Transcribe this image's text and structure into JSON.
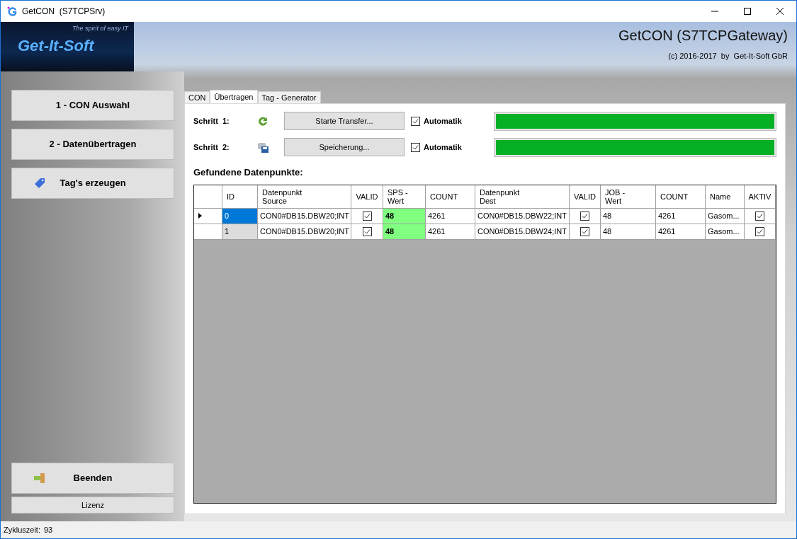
{
  "window": {
    "title": "GetCON  (S7TCPSrv)"
  },
  "header": {
    "logo_text": "Get-It-Soft",
    "logo_slogan": "The spirit of easy IT",
    "title": "GetCON (S7TCPGateway)",
    "copyright": "(c) 2016-2017  by  Get-It-Soft GbR"
  },
  "sidebar": {
    "items": [
      {
        "label": "1 - CON Auswahl",
        "kind": "plain"
      },
      {
        "label": "2 - Datenübertragen",
        "kind": "plain"
      },
      {
        "label": "Tag's erzeugen",
        "kind": "tag"
      }
    ],
    "exit_button": "Beenden",
    "license_button": "Lizenz"
  },
  "tabs": [
    {
      "label": "CON",
      "selected": false
    },
    {
      "label": "Übertragen",
      "selected": true
    },
    {
      "label": "Tag - Generator",
      "selected": false
    }
  ],
  "steps": [
    {
      "label": "Schritt  1:",
      "kind": "refresh",
      "button": "Starte Transfer...",
      "auto_label": "Automatik",
      "auto_checked": true,
      "level": 1
    },
    {
      "label": "Schritt  2:",
      "kind": "save",
      "button": "Speicherung...",
      "auto_label": "Automatik",
      "auto_checked": true,
      "level": 1
    }
  ],
  "table": {
    "title": "Gefundene Datenpunkte:",
    "columns": [
      {
        "label": "ID",
        "kind": "text"
      },
      {
        "label": "Datenpunkt Source",
        "kind": "text"
      },
      {
        "label": "VALID",
        "kind": "check"
      },
      {
        "label": "SPS - Wert",
        "kind": "value"
      },
      {
        "label": "COUNT",
        "kind": "text"
      },
      {
        "label": "Datenpunkt Dest",
        "kind": "text"
      },
      {
        "label": "VALID",
        "kind": "check"
      },
      {
        "label": "JOB - Wert",
        "kind": "text"
      },
      {
        "label": "COUNT",
        "kind": "text"
      },
      {
        "label": "Name",
        "kind": "text"
      },
      {
        "label": "AKTIV",
        "kind": "check"
      }
    ],
    "rows": [
      {
        "selected": true,
        "cells": [
          "0",
          "CON0#DB15.DBW20;INT",
          true,
          "48",
          "4261",
          "CON0#DB15.DBW22;INT",
          true,
          "48",
          "4261",
          "Gasom...",
          true
        ]
      },
      {
        "selected": false,
        "cells": [
          "1",
          "CON0#DB15.DBW20;INT",
          true,
          "48",
          "4261",
          "CON0#DB15.DBW24;INT",
          true,
          "48",
          "4261",
          "Gasom...",
          true
        ]
      }
    ]
  },
  "status_bar": {
    "label": "Zykluszeit:",
    "value": "93"
  }
}
